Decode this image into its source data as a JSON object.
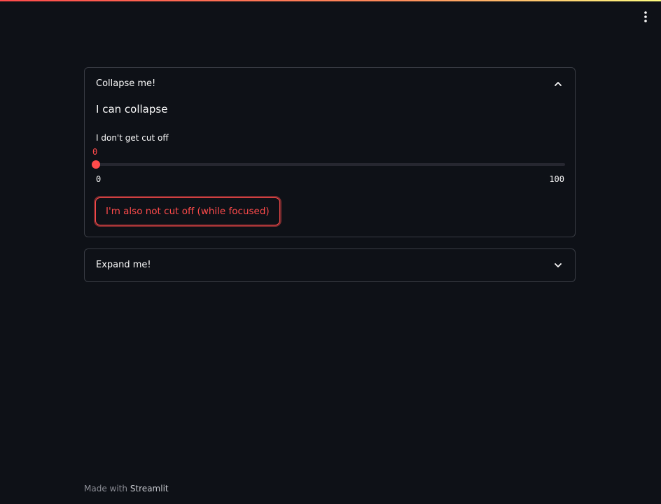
{
  "header": {
    "menu_icon": "kebab-menu-icon"
  },
  "expanders": [
    {
      "label": "Collapse me!",
      "expanded": true,
      "chevron_icon": "chevron-up-icon",
      "content": {
        "text": "I can collapse",
        "slider": {
          "label": "I don't get cut off",
          "value": "0",
          "min": "0",
          "max": "100",
          "fraction": 0
        },
        "button_label": "I'm also not cut off (while focused)"
      }
    },
    {
      "label": "Expand me!",
      "expanded": false,
      "chevron_icon": "chevron-down-icon"
    }
  ],
  "footer": {
    "prefix": "Made with",
    "brand": "Streamlit"
  },
  "colors": {
    "background": "#0e1117",
    "accent": "#ff4b4b",
    "border": "#393c44",
    "text": "#fafafa"
  }
}
